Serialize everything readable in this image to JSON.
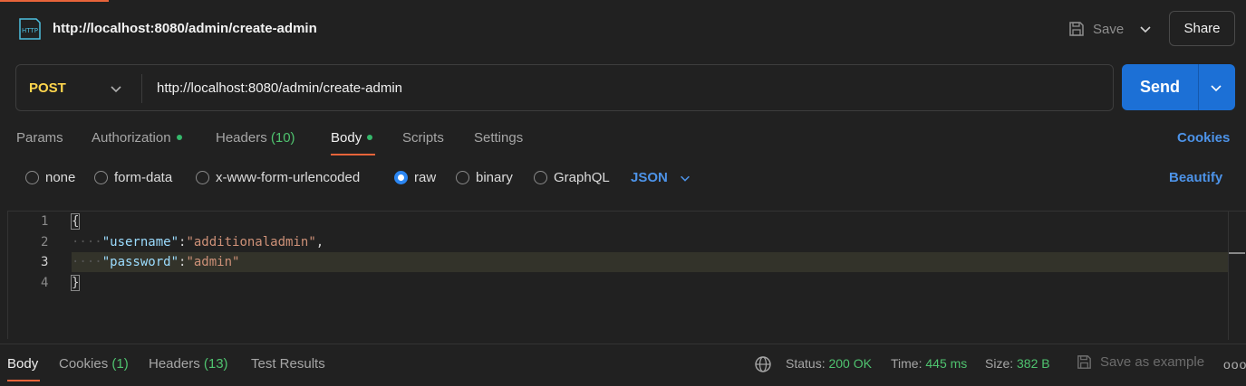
{
  "header": {
    "title": "http://localhost:8080/admin/create-admin",
    "save_label": "Save",
    "share_label": "Share"
  },
  "request": {
    "method": "POST",
    "url": "http://localhost:8080/admin/create-admin",
    "send_label": "Send"
  },
  "tabs": {
    "params": "Params",
    "authorization": "Authorization",
    "headers": "Headers",
    "headers_count": "(10)",
    "body": "Body",
    "scripts": "Scripts",
    "settings": "Settings",
    "cookies": "Cookies"
  },
  "body_types": {
    "none": "none",
    "form_data": "form-data",
    "urlencoded": "x-www-form-urlencoded",
    "raw": "raw",
    "binary": "binary",
    "graphql": "GraphQL",
    "selected": "raw",
    "format": "JSON",
    "beautify": "Beautify"
  },
  "editor": {
    "lines": [
      {
        "num": "1",
        "text": "{"
      },
      {
        "num": "2",
        "key": "\"username\"",
        "value": "\"additionaladmin\"",
        "trail": ","
      },
      {
        "num": "3",
        "key": "\"password\"",
        "value": "\"admin\"",
        "trail": ""
      },
      {
        "num": "4",
        "text": "}"
      }
    ]
  },
  "response": {
    "tabs": {
      "body": "Body",
      "cookies": "Cookies",
      "cookies_count": "(1)",
      "headers": "Headers",
      "headers_count": "(13)",
      "test_results": "Test Results"
    },
    "status_label": "Status:",
    "status_value": "200 OK",
    "time_label": "Time:",
    "time_value": "445 ms",
    "size_label": "Size:",
    "size_value": "382 B",
    "save_example": "Save as example",
    "more": "ooo"
  },
  "colors": {
    "accent_orange": "#e8643a",
    "send_blue": "#1c70d6",
    "link_blue": "#4d93e8",
    "method_yellow": "#ffd64d",
    "success_green": "#4fc36f"
  }
}
